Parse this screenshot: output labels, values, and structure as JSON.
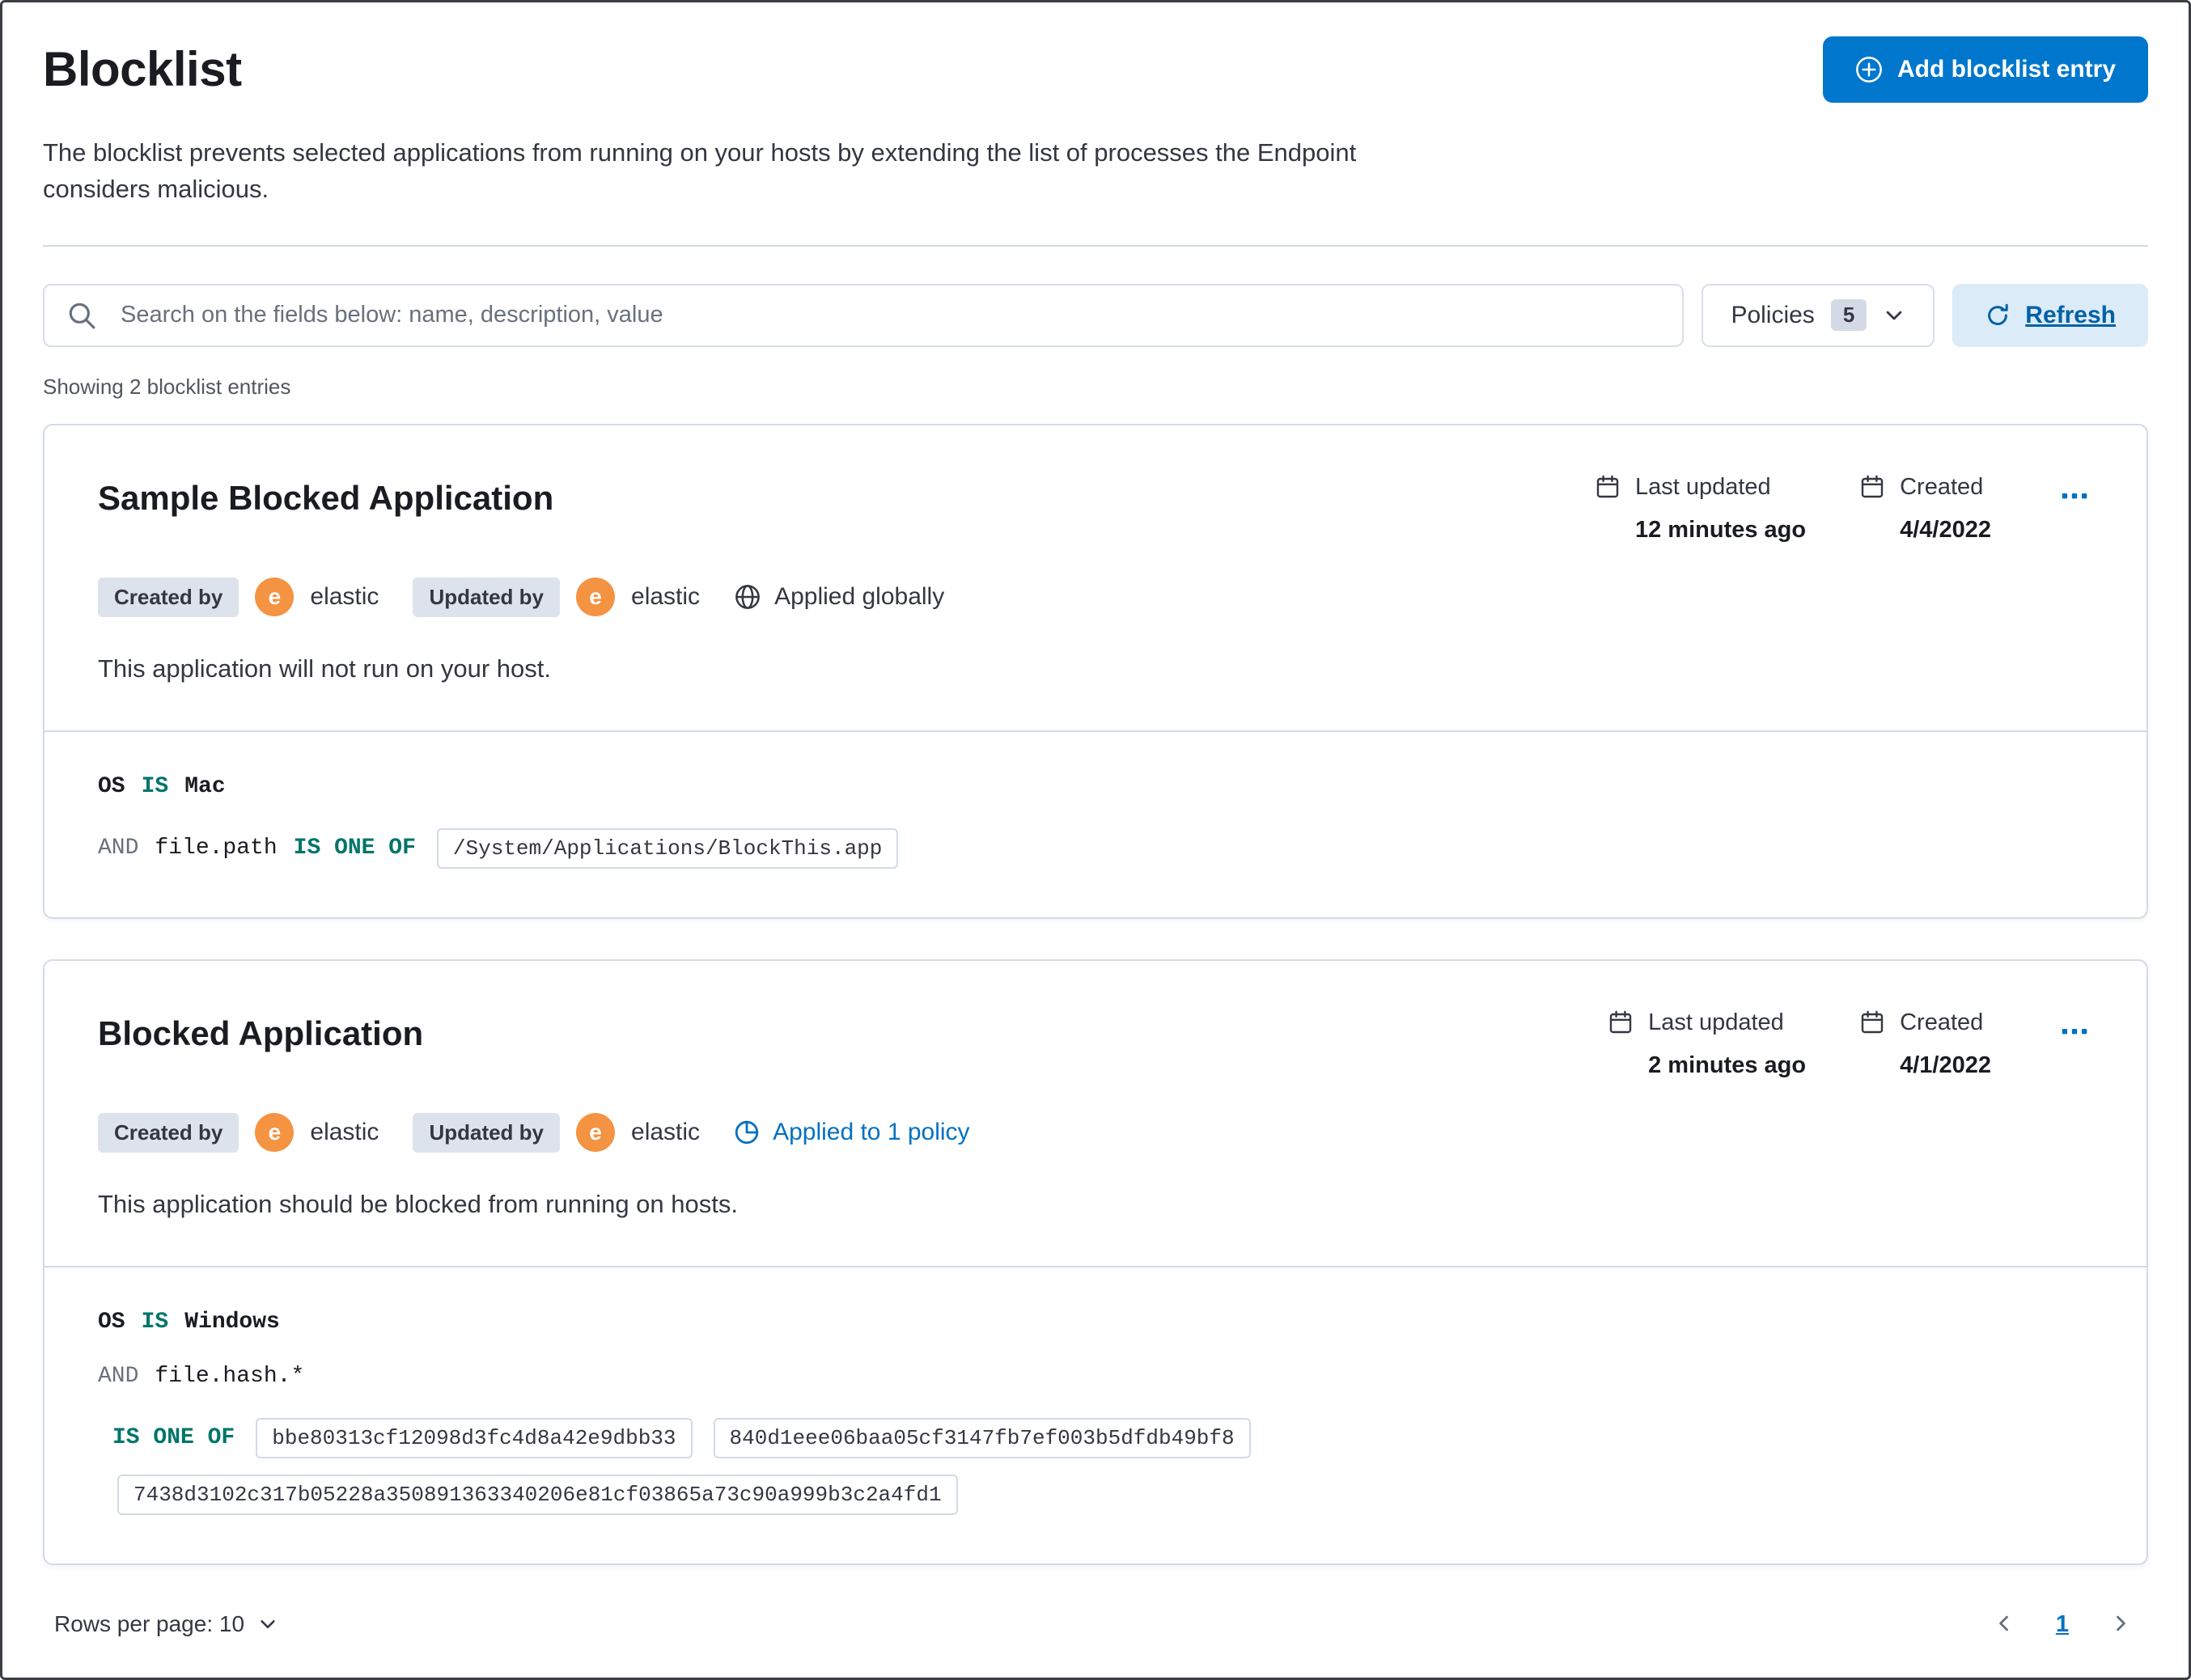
{
  "page": {
    "title": "Blocklist",
    "description": "The blocklist prevents selected applications from running on your hosts by extending the list of processes the Endpoint considers malicious.",
    "add_button_label": "Add blocklist entry",
    "showing_text": "Showing 2 blocklist entries"
  },
  "toolbar": {
    "search_placeholder": "Search on the fields below: name, description, value",
    "policies_label": "Policies",
    "policies_count": "5",
    "refresh_label": "Refresh"
  },
  "entries": [
    {
      "title": "Sample Blocked Application",
      "created_by_label": "Created by",
      "created_by": "elastic",
      "updated_by_label": "Updated by",
      "updated_by": "elastic",
      "avatar_initial": "e",
      "scope": "Applied globally",
      "last_updated_label": "Last updated",
      "last_updated_value": "12 minutes ago",
      "created_label": "Created",
      "created_value": "4/4/2022",
      "description": "This application will not run on your host.",
      "criteria": {
        "field1": "OS",
        "op1": "IS",
        "value1": "Mac",
        "conj": "AND",
        "field2": "file.path",
        "op2": "IS ONE OF",
        "values": [
          "/System/Applications/BlockThis.app"
        ]
      }
    },
    {
      "title": "Blocked Application",
      "created_by_label": "Created by",
      "created_by": "elastic",
      "updated_by_label": "Updated by",
      "updated_by": "elastic",
      "avatar_initial": "e",
      "scope": "Applied to 1 policy",
      "last_updated_label": "Last updated",
      "last_updated_value": "2 minutes ago",
      "created_label": "Created",
      "created_value": "4/1/2022",
      "description": "This application should be blocked from running on hosts.",
      "criteria": {
        "field1": "OS",
        "op1": "IS",
        "value1": "Windows",
        "conj": "AND",
        "field2": "file.hash.*",
        "op2": "IS ONE OF",
        "values": [
          "bbe80313cf12098d3fc4d8a42e9dbb33",
          "840d1eee06baa05cf3147fb7ef003b5dfdb49bf8",
          "7438d3102c317b05228a350891363340206e81cf03865a73c90a999b3c2a4fd1"
        ]
      }
    }
  ],
  "footer": {
    "rows_per_page_label": "Rows per page: 10",
    "page_number": "1"
  },
  "colors": {
    "primary_blue": "#0077cc",
    "link_blue": "#0071c2",
    "operator_teal": "#00756b",
    "avatar_orange": "#f49342",
    "border_gray": "#d3dae6",
    "refresh_bg": "#dcebf8"
  }
}
